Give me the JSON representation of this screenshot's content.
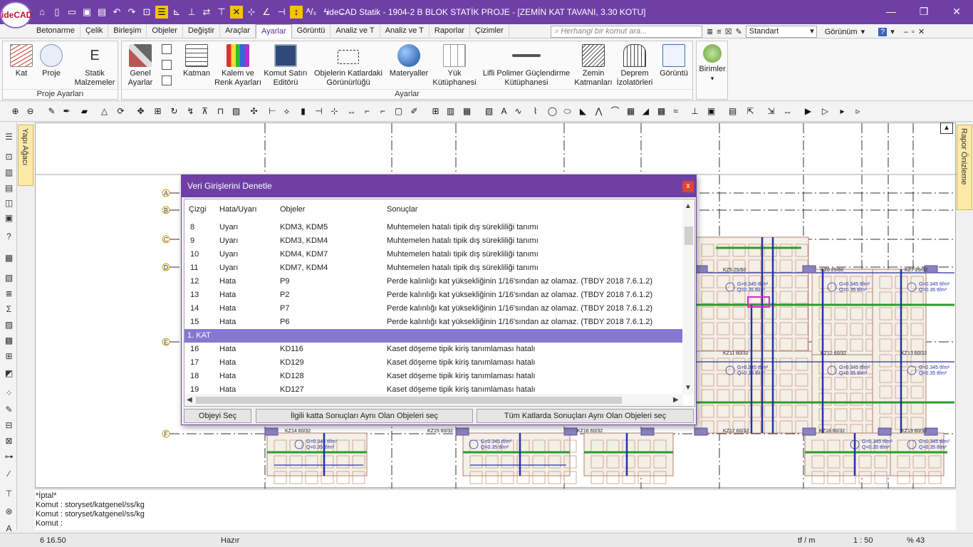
{
  "window": {
    "title": "ideCAD Statik - 1904-2 B BLOK STATİK PROJE - [ZEMİN KAT TAVANI,  3.30 KOTU]",
    "logo": "ideCAD"
  },
  "menu_tabs": [
    "Betonarme",
    "Çelik",
    "Birleşim",
    "Objeler",
    "Değiştir",
    "Araçlar",
    "Ayarlar",
    "Görüntü",
    "Analiz ve T",
    "Analiz ve T",
    "Raporlar",
    "Çizimler"
  ],
  "command_search": {
    "placeholder": "Herhangi bir komut ara..."
  },
  "style_select": {
    "value": "Standart"
  },
  "view_label": "Görünüm",
  "ribbon": {
    "proje_group": {
      "label": "Proje Ayarları",
      "buttons": [
        "Kat",
        "Proje",
        "Statik Malzemeler"
      ]
    },
    "ayarlar_group": {
      "label": "Ayarlar",
      "buttons": [
        "Genel Ayarlar",
        "Katman",
        "Kalem ve Renk Ayarları",
        "Komut Satırı Editörü",
        "Objelerin Katlardaki Görünürlüğü",
        "Materyaller",
        "Yük Kütüphanesi",
        "Lifli Polimer Güçlendirme Kütüphanesi",
        "Zemin Katmanları",
        "Deprem İzolatörleri",
        "Görüntü"
      ]
    },
    "birimler": "Birimler"
  },
  "side_panels": {
    "left": "Yapı Ağacı",
    "right": "Rapor Önizleme"
  },
  "axis_labels": [
    "A",
    "B",
    "C",
    "D",
    "E",
    "F"
  ],
  "dialog": {
    "title": "Veri Girişlerini Denetle",
    "columns": [
      "Çizgi",
      "Hata/Uyarı",
      "Objeler",
      "Sonuçlar"
    ],
    "rows": [
      {
        "line": "8",
        "type": "Uyarı",
        "objects": "KDM3, KDM5",
        "result": "Muhtemelen hatalı tipik dış sürekliliği tanımı"
      },
      {
        "line": "9",
        "type": "Uyarı",
        "objects": "KDM3, KDM4",
        "result": "Muhtemelen hatalı tipik dış sürekliliği tanımı"
      },
      {
        "line": "10",
        "type": "Uyarı",
        "objects": "KDM4, KDM7",
        "result": "Muhtemelen hatalı tipik dış sürekliliği tanımı"
      },
      {
        "line": "11",
        "type": "Uyarı",
        "objects": "KDM7, KDM4",
        "result": "Muhtemelen hatalı tipik dış sürekliliği tanımı"
      },
      {
        "line": "12",
        "type": "Hata",
        "objects": "P9",
        "result": "Perde kalınlığı kat yüksekliğinin 1/16'sından az olamaz.  (TBDY 2018 7.6.1.2)"
      },
      {
        "line": "13",
        "type": "Hata",
        "objects": "P2",
        "result": "Perde kalınlığı kat yüksekliğinin 1/16'sından az olamaz.  (TBDY 2018 7.6.1.2)"
      },
      {
        "line": "14",
        "type": "Hata",
        "objects": "P7",
        "result": "Perde kalınlığı kat yüksekliğinin 1/16'sından az olamaz.  (TBDY 2018 7.6.1.2)"
      },
      {
        "line": "15",
        "type": "Hata",
        "objects": "P6",
        "result": "Perde kalınlığı kat yüksekliğinin 1/16'sından az olamaz.  (TBDY 2018 7.6.1.2)"
      },
      {
        "section": "1. KAT"
      },
      {
        "line": "16",
        "type": "Hata",
        "objects": "KD116",
        "result": "Kaset döşeme tipik kiriş tanımlaması hatalı"
      },
      {
        "line": "17",
        "type": "Hata",
        "objects": "KD129",
        "result": "Kaset döşeme tipik kiriş tanımlaması hatalı"
      },
      {
        "line": "18",
        "type": "Hata",
        "objects": "KD128",
        "result": "Kaset döşeme tipik kiriş tanımlaması hatalı"
      },
      {
        "line": "19",
        "type": "Hata",
        "objects": "KD127",
        "result": "Kaset döşeme tipik kiriş tanımlaması hatalı"
      }
    ],
    "buttons": {
      "select_object": "Objeyi Seç",
      "select_same_floor": "İlgili katta Sonuçları Aynı Olan Objeleri seç",
      "select_all_floors": "Tüm Katlarda Sonuçları Aynı Olan Objeleri seç"
    }
  },
  "console": {
    "lines": [
      "*İptal*",
      "Komut : storyset/katgenel/ss/kg",
      "Komut : storyset/katgenel/ss/kg",
      "Komut :"
    ]
  },
  "status": {
    "coords": "6 16.50",
    "state": "Hazır",
    "units": "tf / m",
    "scale": "1 : 50",
    "zoom": "% 43"
  },
  "drawing_labels": {
    "beams": [
      "KZ5 25/60",
      "KZ6 25/60",
      "KZ7 25/32",
      "KZ11 60/32",
      "KZ12 60/32",
      "KZ13 60/32",
      "KZ14 60/32",
      "KZ15 60/32",
      "KZ16 60/32",
      "KZ17 60/32",
      "KZ18 60/32",
      "KZ19 60/32"
    ],
    "loads": [
      "G=0.345 tf/m²",
      "Q=0.35 tf/m²"
    ]
  }
}
